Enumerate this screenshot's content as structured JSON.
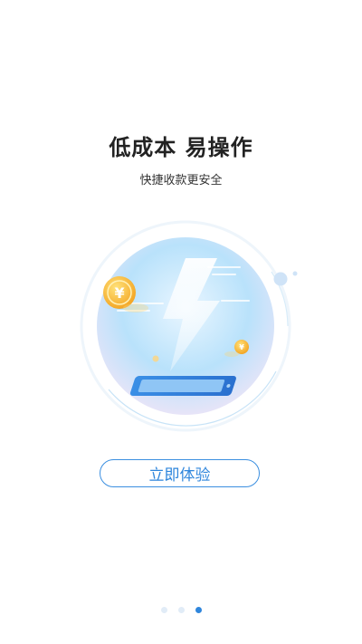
{
  "onboarding": {
    "title": "低成本 易操作",
    "subtitle": "快捷收款更安全",
    "cta_label": "立即体验",
    "page_count": 3,
    "current_page": 3
  },
  "colors": {
    "accent": "#2f86dc",
    "title": "#222222",
    "dot_inactive": "#e1ecf7"
  },
  "icons": {
    "illustration": "lightning-phone-coins-illustration"
  }
}
